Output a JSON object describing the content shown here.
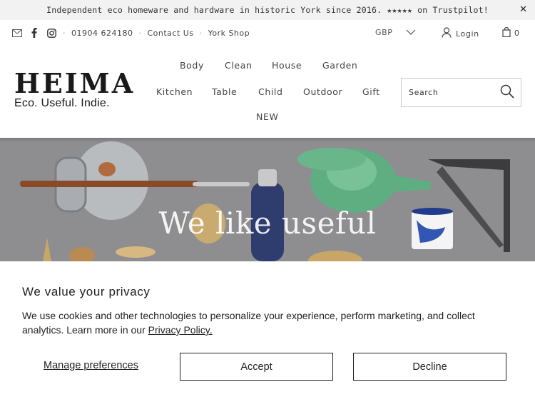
{
  "announcement": {
    "text": "Independent eco homeware and hardware in historic York since 2016. ★★★★★ on Trustpilot!",
    "close_icon": "close-icon",
    "close_glyph": "✕"
  },
  "utility": {
    "phone": "01904 624180",
    "contact": "Contact Us",
    "shop": "York Shop",
    "separator": "·",
    "icons": [
      "mail-icon",
      "facebook-icon",
      "instagram-icon"
    ]
  },
  "currency": {
    "value": "GBP"
  },
  "account": {
    "login": "Login"
  },
  "cart": {
    "count": "0"
  },
  "logo": {
    "title": "HEIMA",
    "tagline": "Eco. Useful. Indie."
  },
  "nav": {
    "body": "Body",
    "clean": "Clean",
    "house": "House",
    "garden": "Garden",
    "kitchen": "Kitchen",
    "table": "Table",
    "child": "Child",
    "outdoor": "Outdoor",
    "gift": "Gift",
    "new": "NEW"
  },
  "search": {
    "placeholder": "Search"
  },
  "hero": {
    "heading": "We like useful"
  },
  "cookie": {
    "title": "We value your privacy",
    "body": "We use cookies and other technologies to personalize your experience, perform marketing, and collect analytics. Learn more in our",
    "policy_link": "Privacy Policy.",
    "manage": "Manage preferences",
    "accept": "Accept",
    "decline": "Decline"
  }
}
